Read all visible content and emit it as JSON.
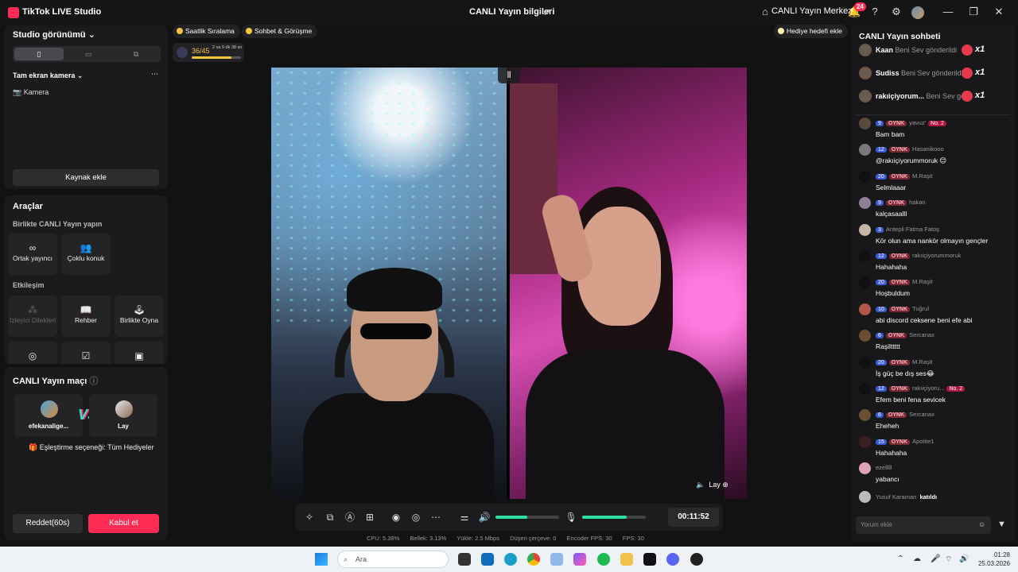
{
  "titlebar": {
    "app_name": "TikTok LIVE Studio",
    "center_title": "CANLI Yayın bilgileri",
    "live_center": "CANLI Yayın Merkezi",
    "notif_count": "24"
  },
  "left": {
    "studio_view": "Studio görünümü",
    "camera_section": "Tam ekran kamera",
    "camera_item": "Kamera",
    "add_source": "Kaynak ekle",
    "tools_title": "Araçlar",
    "collab_title": "Birlikte CANLI Yayın yapın",
    "tools_row1": [
      "Ortak yayıncı",
      "Çoklu konuk"
    ],
    "interact_title": "Etkileşim",
    "tools_row2": [
      "İzleyici Dilekleri",
      "Rehber",
      "Birlikte Oyna"
    ],
    "match_title": "CANLI Yayın maçı",
    "player1": "efekanalige...",
    "player2": "Lay",
    "match_option": "Eşleştirme seçeneği: Tüm Hediyeler",
    "reject": "Reddet(60s)",
    "accept": "Kabul et"
  },
  "center": {
    "pill1": "Saatlik Sıralama",
    "pill2": "Sohbet & Görüşme",
    "pill3": "Hediye hedefi ekle",
    "goal_count": "36/45",
    "goal_time": "2 sa 9 dk 38 sn",
    "goal_progress": 0.8,
    "video_label": "Lay",
    "timer": "00:11:52",
    "speaker_level": 0.5,
    "mic_level": 0.7,
    "stats": [
      "CPU: 5.38%",
      "Bellek: 3.13%",
      "Yükle: 2.5 Mbps",
      "Düşen çerçeve: 0",
      "Encoder FPS: 30",
      "FPS: 30"
    ]
  },
  "chat": {
    "title": "CANLI Yayın sohbeti",
    "gifts": [
      {
        "name": "Kaan",
        "text": "Beni Sev gönderildi",
        "count": "x1"
      },
      {
        "name": "Sudiss",
        "text": "Beni Sev gönderildi",
        "count": "x1"
      },
      {
        "name": "rakıiçiyorum...",
        "text": "Beni Sev gönd",
        "count": "x1"
      }
    ],
    "messages": [
      {
        "level": "9",
        "fan": "OYNK",
        "user": "yavuz'",
        "badge": "No. 2",
        "text": "Bam bam"
      },
      {
        "level": "12",
        "fan": "OYNK",
        "user": "Hasanikooo",
        "badge": "",
        "text": "@rakıiçiyorummoruk 😊"
      },
      {
        "level": "20",
        "fan": "OYNK",
        "user": "M.Raşit",
        "badge": "",
        "text": "Selmlaaar"
      },
      {
        "level": "9",
        "fan": "OYNK",
        "user": "hakan",
        "badge": "",
        "text": "kalçasaalll"
      },
      {
        "level": "3",
        "fan": "",
        "user": "Antepli Fatma Fatoş",
        "badge": "",
        "text": "Kör olun ama nankör olmayın gençler"
      },
      {
        "level": "12",
        "fan": "OYNK",
        "user": "rakıiçiyorummoruk",
        "badge": "",
        "text": "Hahahaha"
      },
      {
        "level": "20",
        "fan": "OYNK",
        "user": "M.Raşit",
        "badge": "",
        "text": "Hoşbuldum"
      },
      {
        "level": "10",
        "fan": "OYNK",
        "user": "Tuğrul",
        "badge": "",
        "text": "abi discord ceksene beni efe abi"
      },
      {
        "level": "6",
        "fan": "OYNK",
        "user": "Sercanax",
        "badge": "",
        "text": "Raşilttttt"
      },
      {
        "level": "20",
        "fan": "OYNK",
        "user": "M.Raşit",
        "badge": "",
        "text": "İş güç be dış ses😂"
      },
      {
        "level": "12",
        "fan": "OYNK",
        "user": "rakıiçiyoru...",
        "badge": "No. 2",
        "text": "Efem beni fena sevicek"
      },
      {
        "level": "6",
        "fan": "OYNK",
        "user": "Sercanax",
        "badge": "",
        "text": "Eheheh"
      },
      {
        "level": "15",
        "fan": "OYNK",
        "user": "Apotite1",
        "badge": "",
        "text": "Hahahaha"
      },
      {
        "level": "",
        "fan": "",
        "user": "ezelllll",
        "badge": "",
        "text": "yabancı"
      }
    ],
    "join_user": "Yusuf Karaman",
    "join_text": "katıldı",
    "input_placeholder": "Yorum ekle"
  },
  "taskbar": {
    "search": "Ara",
    "time": "01:28",
    "date": "25.03.2026"
  }
}
